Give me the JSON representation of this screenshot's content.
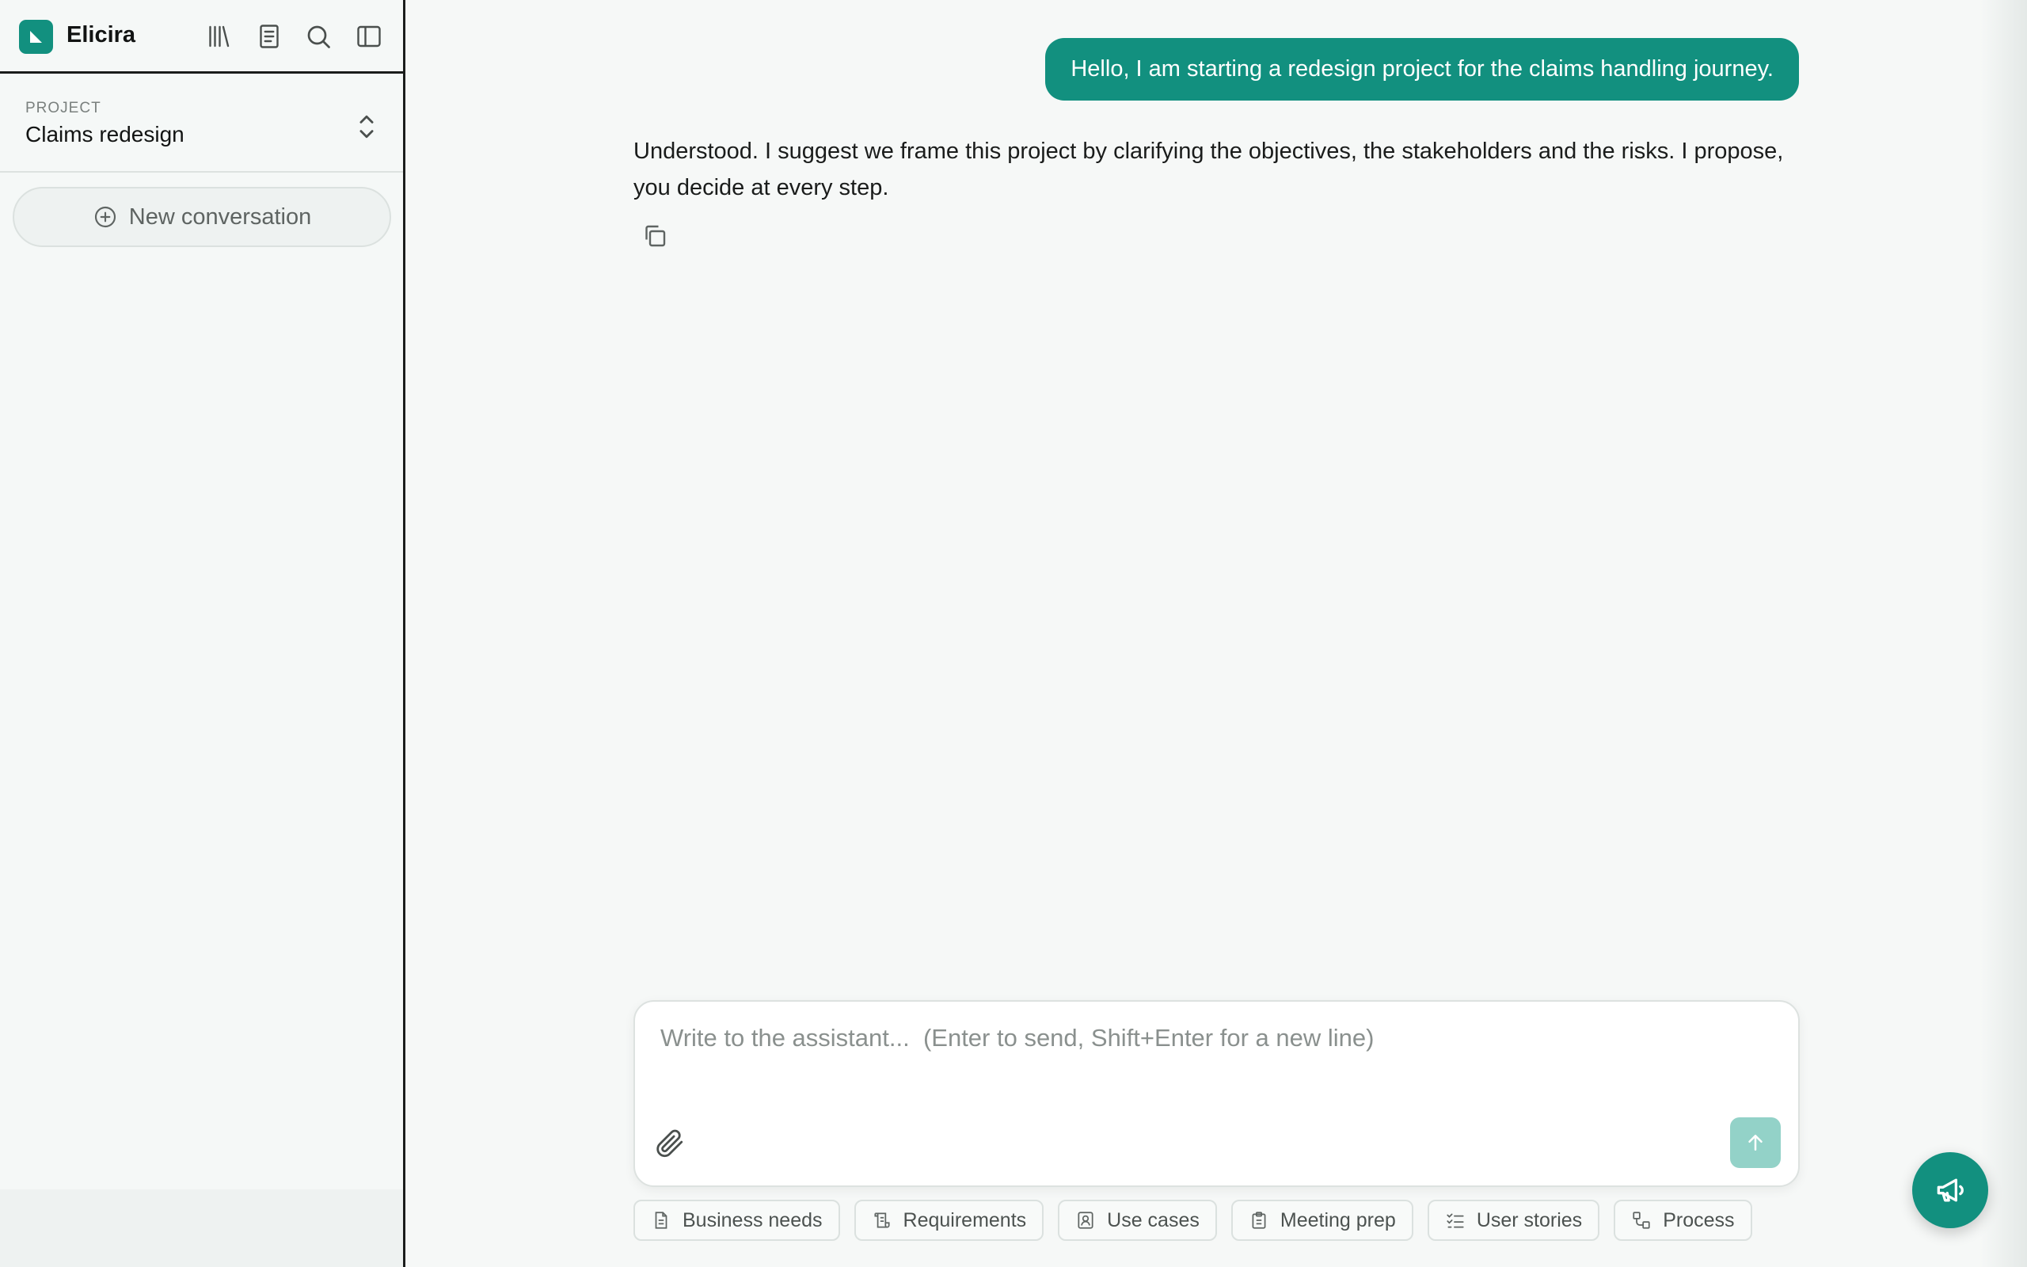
{
  "app": {
    "name": "Elicira"
  },
  "header_icons": [
    "library-icon",
    "notebook-icon",
    "search-icon",
    "sidebar-toggle-icon"
  ],
  "project": {
    "label": "PROJECT",
    "name": "Claims redesign"
  },
  "sidebar": {
    "new_conversation_label": "New conversation"
  },
  "conversation": {
    "user_message": "Hello, I am starting a redesign project for the claims handling journey.",
    "assistant_message": "Understood. I suggest we frame this project by clarifying the objectives, the stakeholders and the risks. I propose, you decide at every step."
  },
  "composer": {
    "placeholder": "Write to the assistant...  (Enter to send, Shift+Enter for a new line)",
    "value": ""
  },
  "chips": [
    {
      "label": "Business needs",
      "icon": "document-icon"
    },
    {
      "label": "Requirements",
      "icon": "scroll-icon"
    },
    {
      "label": "Use cases",
      "icon": "user-card-icon"
    },
    {
      "label": "Meeting prep",
      "icon": "clipboard-icon"
    },
    {
      "label": "User stories",
      "icon": "checklist-icon"
    },
    {
      "label": "Process",
      "icon": "flow-icon"
    }
  ],
  "colors": {
    "accent": "#12907f",
    "send_disabled": "#93d2c8",
    "background": "#f6f8f7"
  }
}
